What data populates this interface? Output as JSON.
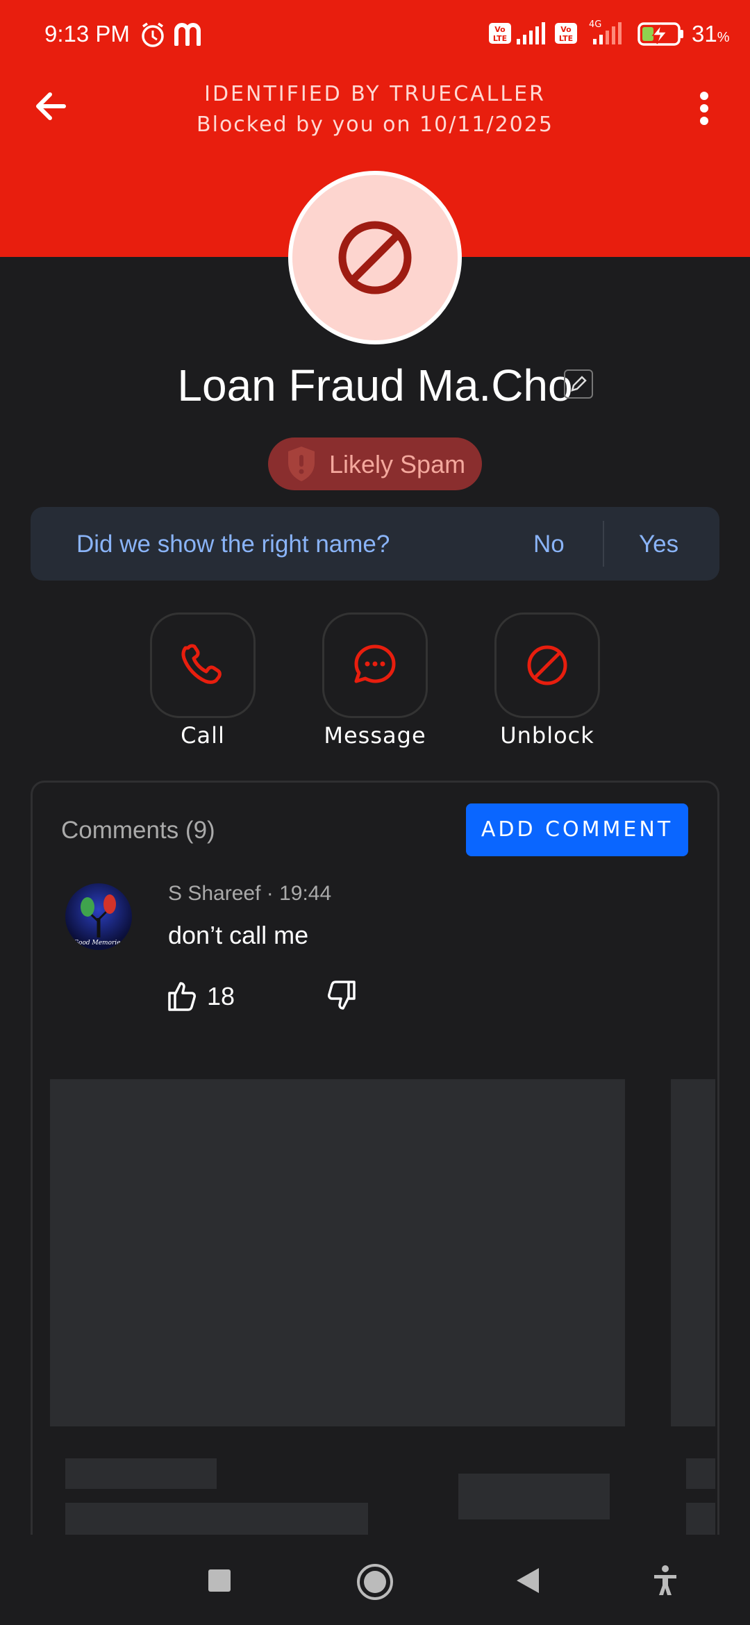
{
  "status_bar": {
    "time": "9:13 PM",
    "battery_percent": "31",
    "battery_unit": "%",
    "network_badge": "4G",
    "icons": [
      "alarm-icon",
      "app-m-icon",
      "volte-icon",
      "signal-icon",
      "volte-icon",
      "signal-4g-icon",
      "battery-charging-icon"
    ]
  },
  "header": {
    "title": "IDENTIFIED BY TRUECALLER",
    "subtitle": "Blocked by you on 10/11/2025",
    "color": "#e81e0e"
  },
  "contact": {
    "name": "Loan Fraud Ma.Cho",
    "badge": "Likely Spam"
  },
  "name_check": {
    "question": "Did we show the right name?",
    "no": "No",
    "yes": "Yes"
  },
  "actions": [
    {
      "label": "Call",
      "icon": "phone-icon"
    },
    {
      "label": "Message",
      "icon": "message-icon"
    },
    {
      "label": "Unblock",
      "icon": "block-icon"
    }
  ],
  "comments": {
    "title": "Comments (9)",
    "add_button": "ADD COMMENT",
    "items": [
      {
        "author": "S Shareef",
        "time": "19:44",
        "meta": "S Shareef · 19:44",
        "text": "don’t call me",
        "likes": "18"
      }
    ]
  },
  "navbar": {
    "icons": [
      "recents-square-icon",
      "home-circle-icon",
      "back-triangle-icon",
      "accessibility-icon"
    ]
  },
  "colors": {
    "accent_red": "#e81e0e",
    "link_blue": "#8ab4f8",
    "button_blue": "#0a66ff",
    "background": "#1c1c1e"
  }
}
